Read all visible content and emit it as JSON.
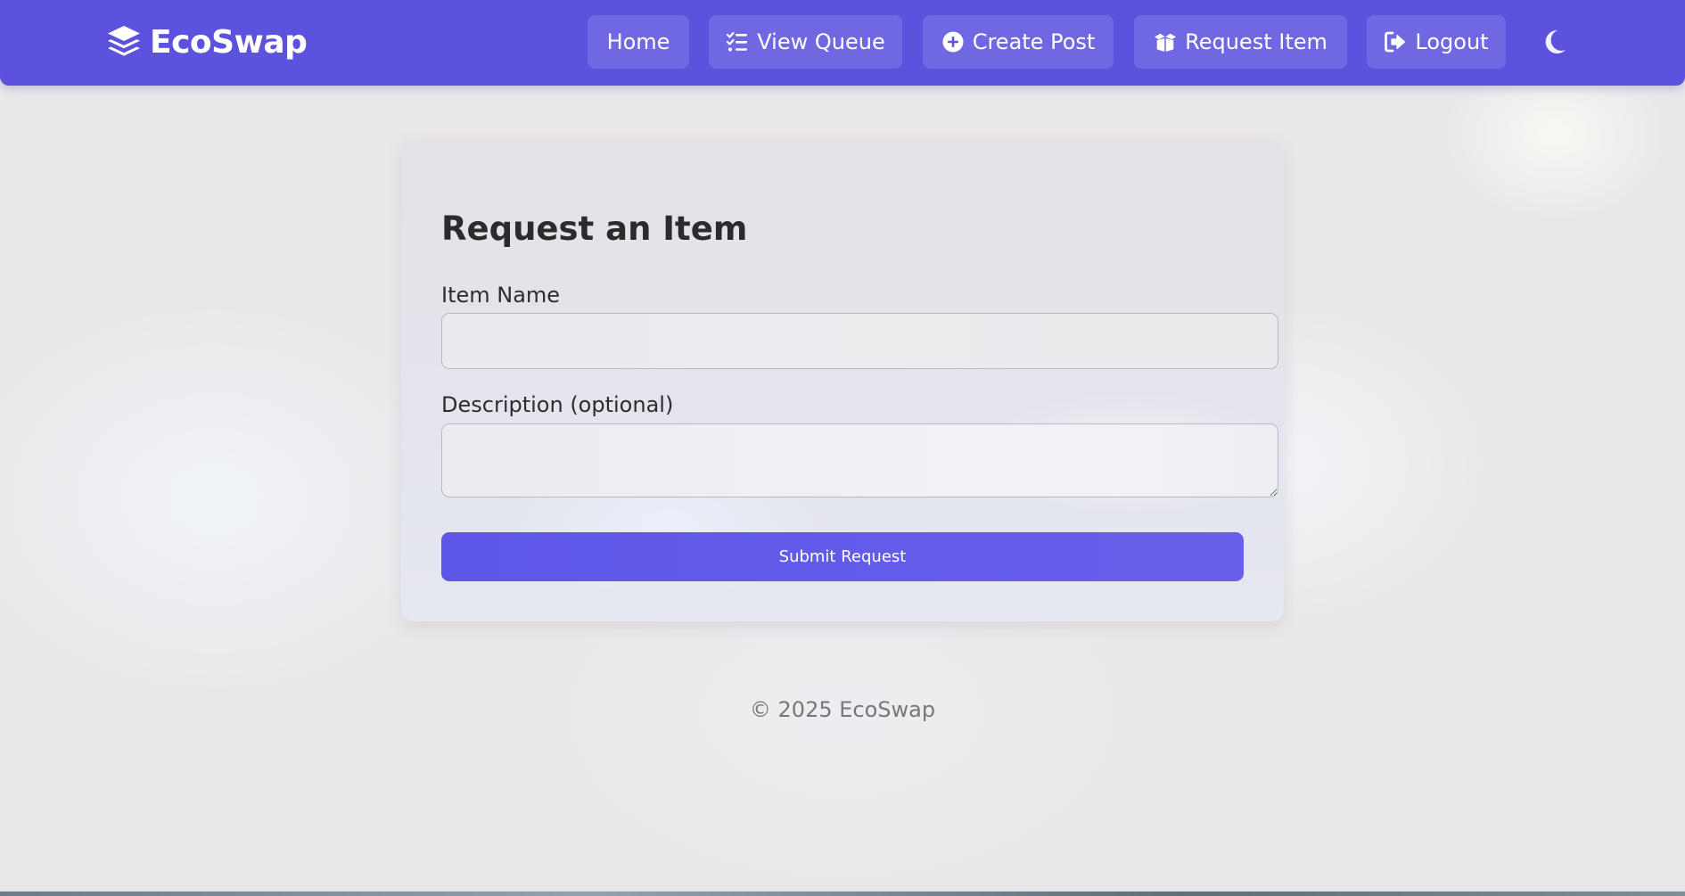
{
  "navbar": {
    "brand": "EcoSwap",
    "brand_icon": "layers-icon",
    "items": [
      {
        "label": "Home",
        "icon": ""
      },
      {
        "label": "View Queue",
        "icon": "list-check-icon"
      },
      {
        "label": "Create Post",
        "icon": "plus-circle-icon"
      },
      {
        "label": "Request Item",
        "icon": "box-open-icon"
      },
      {
        "label": "Logout",
        "icon": "sign-out-icon"
      }
    ],
    "theme_toggle_icon": "moon-icon"
  },
  "form": {
    "title": "Request an Item",
    "item_name_label": "Item Name",
    "item_name_value": "",
    "description_label": "Description (optional)",
    "description_value": "",
    "submit_label": "Submit Request"
  },
  "footer": {
    "text": "© 2025 EcoSwap"
  },
  "colors": {
    "primary": "#5d52de",
    "button": "#635be9",
    "background": "#ebe8ea",
    "text_dark": "#2d2a2c",
    "footer_text": "#7a7779"
  }
}
